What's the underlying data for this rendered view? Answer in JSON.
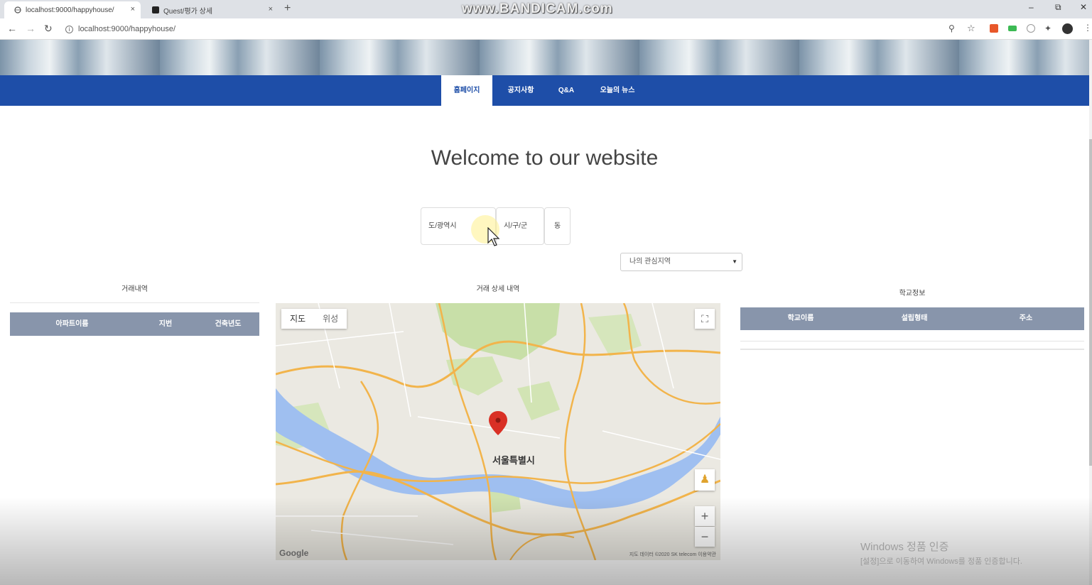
{
  "browser": {
    "tabs": [
      {
        "title": "localhost:9000/happyhouse/"
      },
      {
        "title": "Quest/평가 상세"
      }
    ],
    "new_tab": "+",
    "close": "×",
    "watermark": "www.BANDICAM.com",
    "url": "localhost:9000/happyhouse/",
    "window_controls": [
      "–",
      "⧉",
      "✕"
    ]
  },
  "nav": {
    "items": [
      {
        "label": "홈페이지"
      },
      {
        "label": "공지사항"
      },
      {
        "label": "Q&A"
      },
      {
        "label": "오늘의 뉴스"
      }
    ]
  },
  "welcome": "Welcome to our website",
  "selects": {
    "sido": "도/광역시",
    "gugun": "시/구/군",
    "dong": "동",
    "favorite": "나의 관심지역"
  },
  "sections": {
    "deals": {
      "title": "거래내역",
      "columns": [
        "아파트이름",
        "지번",
        "건축년도"
      ]
    },
    "detail": {
      "title": "거래 상세 내역"
    },
    "school": {
      "title": "학교정보",
      "columns": [
        "학교이름",
        "설립형태",
        "주소"
      ]
    }
  },
  "map": {
    "type_map": "지도",
    "type_satellite": "위성",
    "city_label": "서울특별시",
    "logo": "Google",
    "attribution": "지도 데이터 ©2020 SK telecom  이용약관",
    "zoom_in": "+",
    "zoom_out": "−",
    "colors": {
      "water": "#9fbff0",
      "highway": "#f2b44b",
      "park": "#c8dfa8",
      "marker": "#d93025"
    }
  },
  "windows_notice": {
    "title": "Windows 정품 인증",
    "text": "[설정]으로 이동하여 Windows를 정품 인증합니다."
  }
}
